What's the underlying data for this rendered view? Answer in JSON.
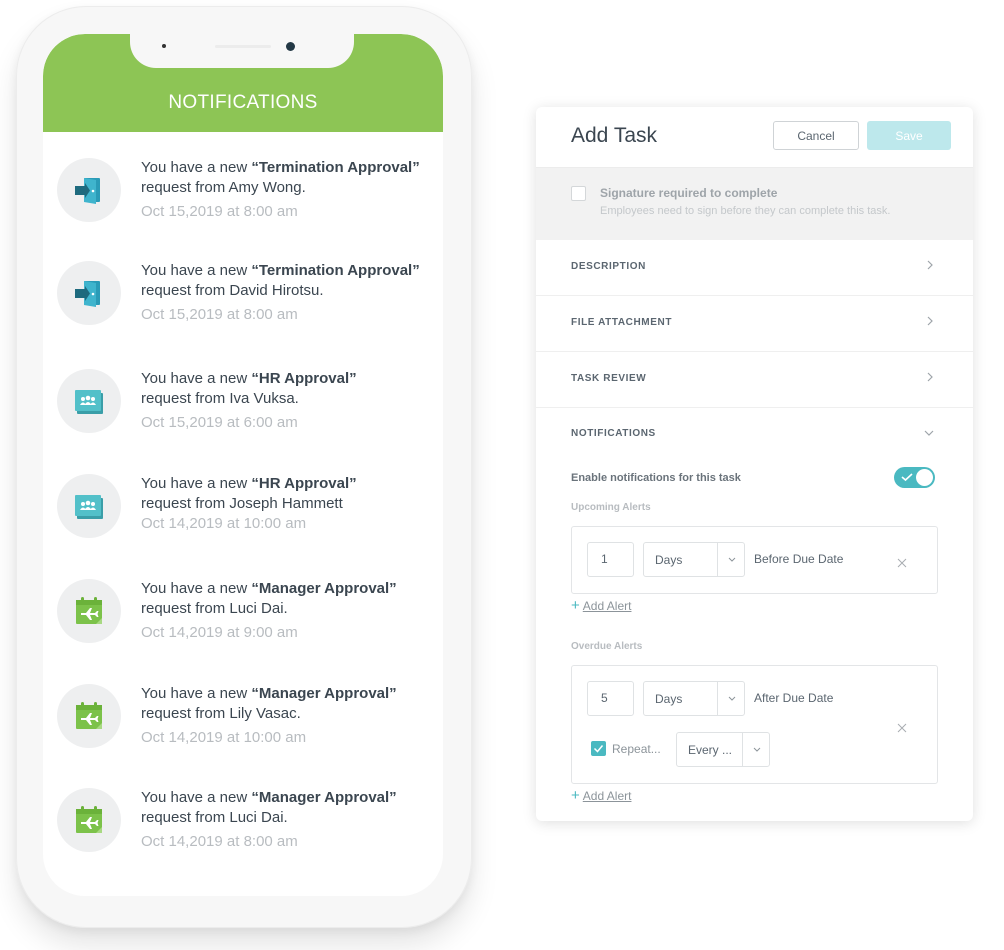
{
  "phone": {
    "header_title": "NOTIFICATIONS",
    "header_color": "#8dc555",
    "notifications": [
      {
        "prefix": "You have a new ",
        "type": "“Termination Approval”",
        "from": "request from Amy Wong.",
        "time": "Oct 15,2019 at 8:00 am",
        "icon": "door-exit-icon"
      },
      {
        "prefix": "You have a new ",
        "type": "“Termination Approval”",
        "from": "request from David Hirotsu.",
        "time": "Oct 15,2019 at 8:00 am",
        "icon": "door-exit-icon"
      },
      {
        "prefix": "You have a new ",
        "type": "“HR Approval”",
        "from": "request from Iva Vuksa.",
        "time": "Oct 15,2019 at 6:00 am",
        "icon": "people-folder-icon"
      },
      {
        "prefix": "You have a new ",
        "type": "“HR Approval”",
        "from": "request  from Joseph Hammett",
        "time": "Oct 14,2019 at 10:00 am",
        "icon": "people-folder-icon"
      },
      {
        "prefix": "You have a new ",
        "type": "“Manager Approval”",
        "from": "request from Luci Dai.",
        "time": "Oct 14,2019 at 9:00 am",
        "icon": "calendar-plane-icon"
      },
      {
        "prefix": "You have a new ",
        "type": "“Manager Approval”",
        "from": "request from Lily Vasac.",
        "time": "Oct 14,2019 at 10:00 am",
        "icon": "calendar-plane-icon"
      },
      {
        "prefix": "You have a new ",
        "type": "“Manager Approval”",
        "from": "request from Luci Dai.",
        "time": "Oct 14,2019 at 8:00 am",
        "icon": "calendar-plane-icon"
      }
    ]
  },
  "panel": {
    "title": "Add Task",
    "cancel_label": "Cancel",
    "save_label": "Save",
    "signature": {
      "title": "Signature required to complete",
      "subtitle": "Employees need to sign before they can complete this task.",
      "checked": false
    },
    "sections": [
      {
        "label": "DESCRIPTION",
        "expanded": false
      },
      {
        "label": "FILE ATTACHMENT",
        "expanded": false
      },
      {
        "label": "TASK REVIEW",
        "expanded": false
      },
      {
        "label": "NOTIFICATIONS",
        "expanded": true
      }
    ],
    "notifications": {
      "enable_label": "Enable notifications for this task",
      "enabled": true,
      "upcoming": {
        "label": "Upcoming Alerts",
        "alert": {
          "amount": "1",
          "unit": "Days",
          "relation": "Before Due Date"
        },
        "add_label": "Add Alert"
      },
      "overdue": {
        "label": "Overdue Alerts",
        "alert": {
          "amount": "5",
          "unit": "Days",
          "relation": "After Due Date",
          "repeat_checked": true,
          "repeat_label": "Repeat...",
          "repeat_value": "Every ..."
        },
        "add_label": "Add Alert"
      }
    },
    "accent_color": "#4ab9c1"
  }
}
